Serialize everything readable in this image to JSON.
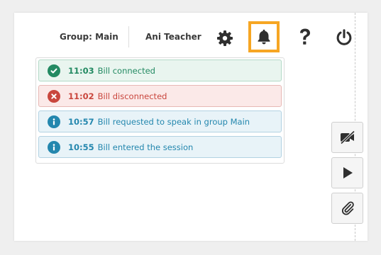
{
  "header": {
    "group_label": "Group: Main",
    "user_name": "Ani Teacher"
  },
  "icons": {
    "settings": "gear-icon",
    "notifications": "bell-icon",
    "help": "question-mark-icon",
    "power": "power-icon"
  },
  "notifications": [
    {
      "type": "success",
      "time": "11:03",
      "text": "Bill connected",
      "icon": "check-circle-icon"
    },
    {
      "type": "danger",
      "time": "11:02",
      "text": "Bill disconnected",
      "icon": "x-circle-icon"
    },
    {
      "type": "info",
      "time": "10:57",
      "text": "Bill requested to speak in group Main",
      "icon": "info-circle-icon"
    },
    {
      "type": "info",
      "time": "10:55",
      "text": "Bill entered the session",
      "icon": "info-circle-icon"
    }
  ],
  "side_buttons": [
    "video-off-icon",
    "play-icon",
    "paperclip-icon"
  ],
  "colors": {
    "highlight": "#f6a623",
    "success": "#238a62",
    "danger": "#c9463d",
    "info": "#2487ae"
  }
}
